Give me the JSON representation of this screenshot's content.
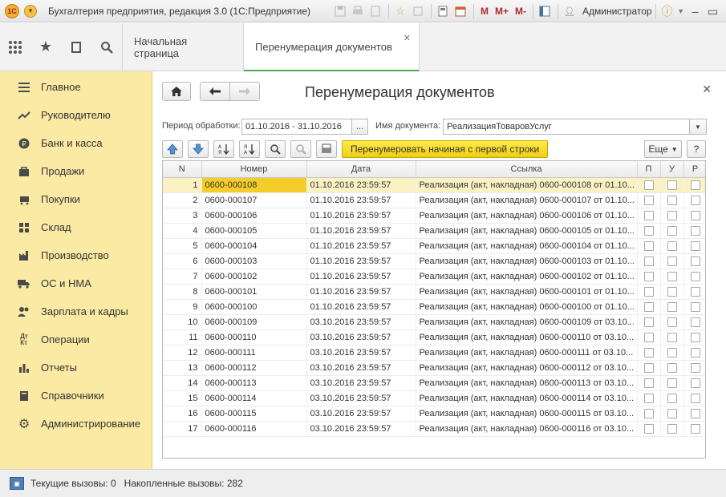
{
  "window": {
    "title": "Бухгалтерия предприятия, редакция 3.0  (1С:Предприятие)",
    "user": "Администратор",
    "memory_buttons": [
      "M",
      "M+",
      "M-"
    ]
  },
  "sections_panel": {
    "icons": [
      "apps-icon",
      "star-icon",
      "history-icon",
      "search-icon"
    ]
  },
  "tabs": [
    {
      "label": "Начальная страница",
      "active": false
    },
    {
      "label": "Перенумерация документов",
      "active": true
    }
  ],
  "sidebar": {
    "items": [
      {
        "label": "Главное",
        "icon": "menu-icon"
      },
      {
        "label": "Руководителю",
        "icon": "trend-icon"
      },
      {
        "label": "Банк и касса",
        "icon": "ruble-icon"
      },
      {
        "label": "Продажи",
        "icon": "bag-icon"
      },
      {
        "label": "Покупки",
        "icon": "cart-icon"
      },
      {
        "label": "Склад",
        "icon": "warehouse-icon"
      },
      {
        "label": "Производство",
        "icon": "factory-icon"
      },
      {
        "label": "ОС и НМА",
        "icon": "truck-icon"
      },
      {
        "label": "Зарплата и кадры",
        "icon": "people-icon"
      },
      {
        "label": "Операции",
        "icon": "dt-kt-icon"
      },
      {
        "label": "Отчеты",
        "icon": "bar-chart-icon"
      },
      {
        "label": "Справочники",
        "icon": "book-icon"
      },
      {
        "label": "Администрирование",
        "icon": "gear-icon"
      }
    ]
  },
  "form": {
    "title": "Перенумерация документов",
    "period_label": "Период обработки:",
    "period_value": "01.10.2016 - 31.10.2016",
    "period_button": "...",
    "doc_label": "Имя документа:",
    "doc_value": "РеализацияТоваровУслуг",
    "renumber_button": "Перенумеровать начиная с первой строки",
    "more_button": "Еще",
    "help_button": "?"
  },
  "table": {
    "columns": [
      "N",
      "Номер",
      "Дата",
      "Ссылка",
      "П",
      "У",
      "Р"
    ],
    "selected_row": 1,
    "rows": [
      {
        "n": "1",
        "number": "0600-000108",
        "date": "01.10.2016 23:59:57",
        "ref": "Реализация (акт, накладная) 0600-000108 от 01.10..."
      },
      {
        "n": "2",
        "number": "0600-000107",
        "date": "01.10.2016 23:59:57",
        "ref": "Реализация (акт, накладная) 0600-000107 от 01.10..."
      },
      {
        "n": "3",
        "number": "0600-000106",
        "date": "01.10.2016 23:59:57",
        "ref": "Реализация (акт, накладная) 0600-000106 от 01.10..."
      },
      {
        "n": "4",
        "number": "0600-000105",
        "date": "01.10.2016 23:59:57",
        "ref": "Реализация (акт, накладная) 0600-000105 от 01.10..."
      },
      {
        "n": "5",
        "number": "0600-000104",
        "date": "01.10.2016 23:59:57",
        "ref": "Реализация (акт, накладная) 0600-000104 от 01.10..."
      },
      {
        "n": "6",
        "number": "0600-000103",
        "date": "01.10.2016 23:59:57",
        "ref": "Реализация (акт, накладная) 0600-000103 от 01.10..."
      },
      {
        "n": "7",
        "number": "0600-000102",
        "date": "01.10.2016 23:59:57",
        "ref": "Реализация (акт, накладная) 0600-000102 от 01.10..."
      },
      {
        "n": "8",
        "number": "0600-000101",
        "date": "01.10.2016 23:59:57",
        "ref": "Реализация (акт, накладная) 0600-000101 от 01.10..."
      },
      {
        "n": "9",
        "number": "0600-000100",
        "date": "01.10.2016 23:59:57",
        "ref": "Реализация (акт, накладная) 0600-000100 от 01.10..."
      },
      {
        "n": "10",
        "number": "0600-000109",
        "date": "03.10.2016 23:59:57",
        "ref": "Реализация (акт, накладная) 0600-000109 от 03.10..."
      },
      {
        "n": "11",
        "number": "0600-000110",
        "date": "03.10.2016 23:59:57",
        "ref": "Реализация (акт, накладная) 0600-000110 от 03.10..."
      },
      {
        "n": "12",
        "number": "0600-000111",
        "date": "03.10.2016 23:59:57",
        "ref": "Реализация (акт, накладная) 0600-000111 от 03.10..."
      },
      {
        "n": "13",
        "number": "0600-000112",
        "date": "03.10.2016 23:59:57",
        "ref": "Реализация (акт, накладная) 0600-000112 от 03.10..."
      },
      {
        "n": "14",
        "number": "0600-000113",
        "date": "03.10.2016 23:59:57",
        "ref": "Реализация (акт, накладная) 0600-000113 от 03.10..."
      },
      {
        "n": "15",
        "number": "0600-000114",
        "date": "03.10.2016 23:59:57",
        "ref": "Реализация (акт, накладная) 0600-000114 от 03.10..."
      },
      {
        "n": "16",
        "number": "0600-000115",
        "date": "03.10.2016 23:59:57",
        "ref": "Реализация (акт, накладная) 0600-000115 от 03.10..."
      },
      {
        "n": "17",
        "number": "0600-000116",
        "date": "03.10.2016 23:59:57",
        "ref": "Реализация (акт, накладная) 0600-000116 от 03.10..."
      }
    ]
  },
  "status": {
    "text": "Текущие вызовы: 0   Накопленные вызовы: 282"
  },
  "colors": {
    "sidebar_bg": "#fbeaa4",
    "accent_yellow": "#f0cf12",
    "active_tab_underline": "#52a852",
    "selected_row": "#fbf2c4"
  }
}
